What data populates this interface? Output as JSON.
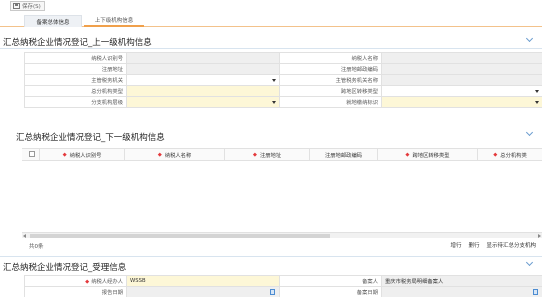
{
  "toolbar": {
    "save_label": "保存(S)"
  },
  "tabs": [
    {
      "label": "备案总体信息"
    },
    {
      "label": "上下级机构信息"
    }
  ],
  "upper_section": {
    "title": "汇总纳税企业情况登记_上一级机构信息",
    "rows": [
      {
        "left_label": "纳税人识别号",
        "left_value": "",
        "right_label": "纳税人名称",
        "right_value": ""
      },
      {
        "left_label": "注册地址",
        "left_value": "",
        "right_label": "注册地邮政编码",
        "right_value": ""
      },
      {
        "left_label": "主管税务机关",
        "left_value": "",
        "right_label": "主管税务机关名称",
        "right_value": ""
      },
      {
        "left_label": "总分机构类型",
        "left_value": "",
        "right_label": "跨地区转移类型",
        "right_value": ""
      },
      {
        "left_label": "分支机构层级",
        "left_value": "",
        "right_label": "就地缴纳标识",
        "right_value": ""
      }
    ]
  },
  "lower_section": {
    "title": "汇总纳税企业情况登记_下一级机构信息",
    "columns": [
      {
        "label": "纳税人识别号",
        "required": true
      },
      {
        "label": "纳税人名称",
        "required": true
      },
      {
        "label": "注册地址",
        "required": true
      },
      {
        "label": "注册地邮政编码",
        "required": false
      },
      {
        "label": "跨地区转移类型",
        "required": true
      },
      {
        "label": "总分机构类",
        "required": true
      }
    ],
    "row_count_text": "共0条",
    "actions": {
      "add_row": "增行",
      "delete_row": "删行",
      "show_summary": "显示待汇总分支机构"
    }
  },
  "accept_section": {
    "title": "汇总纳税企业情况登记_受理信息",
    "handler_label": "纳税人经办人",
    "handler_value": "WSSB",
    "filer_label": "备案人",
    "filer_value": "重庆市税务局明细备案人",
    "date_label_left": "报告日期",
    "date_label_right": "备案日期"
  },
  "colors": {
    "required_bg": "#fdf7d7",
    "readonly_bg": "#efefef",
    "required_mark": "#e4393c",
    "tab_accent": "#f0a04b",
    "chevron": "#6a9ccf"
  }
}
